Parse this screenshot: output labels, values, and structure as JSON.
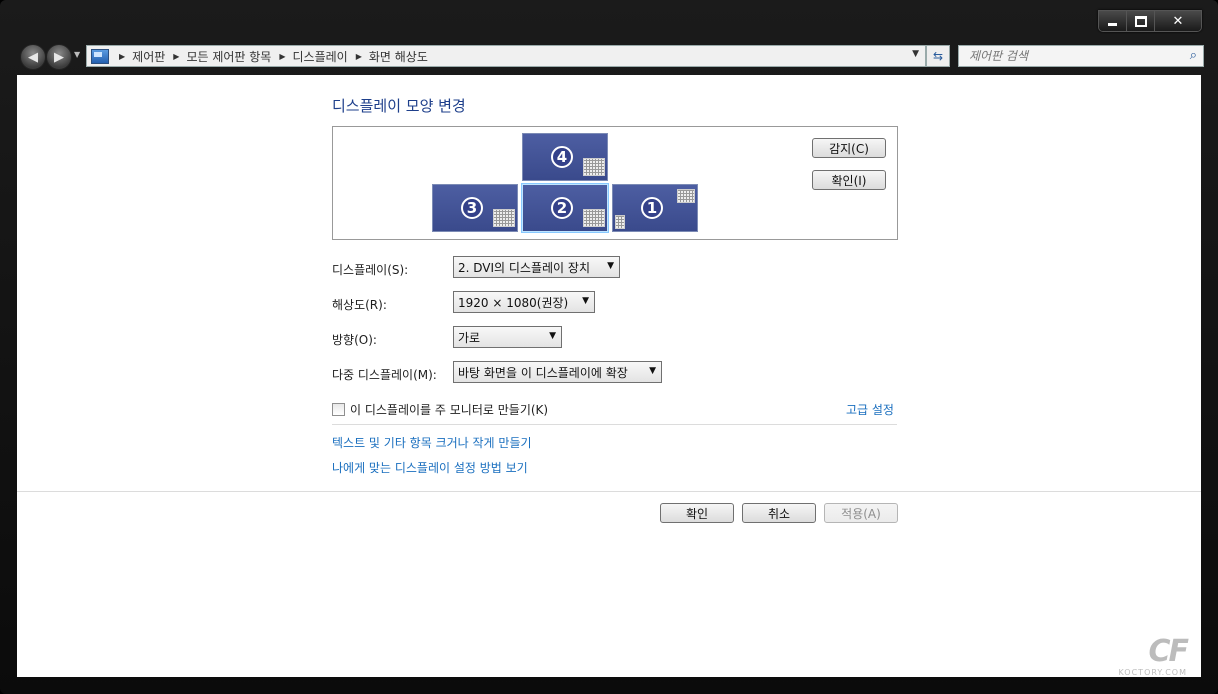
{
  "window": {
    "minimize": "",
    "maximize": "",
    "close": "✕"
  },
  "nav": {
    "breadcrumbs": [
      "제어판",
      "모든 제어판 항목",
      "디스플레이",
      "화면 해상도"
    ],
    "search_placeholder": "제어판 검색"
  },
  "page": {
    "title": "디스플레이 모양 변경",
    "detect_button": "감지(C)",
    "identify_button": "확인(I)",
    "monitors": [
      {
        "number": "4",
        "selected": false
      },
      {
        "number": "3",
        "selected": false
      },
      {
        "number": "2",
        "selected": true
      },
      {
        "number": "1",
        "selected": false
      }
    ],
    "fields": {
      "display": {
        "label": "디스플레이(S):",
        "value": "2. DVI의 디스플레이 장치"
      },
      "resolution": {
        "label": "해상도(R):",
        "value": "1920 × 1080(권장)"
      },
      "orientation": {
        "label": "방향(O):",
        "value": "가로"
      },
      "multiple": {
        "label": "다중 디스플레이(M):",
        "value": "바탕 화면을 이 디스플레이에 확장"
      }
    },
    "make_main_checkbox": "이 디스플레이를 주 모니터로 만들기(K)",
    "make_main_checked": false,
    "advanced_link": "고급 설정",
    "links": [
      "텍스트 및 기타 항목 크거나 작게 만들기",
      "나에게 맞는 디스플레이 설정 방법 보기"
    ],
    "ok_button": "확인",
    "cancel_button": "취소",
    "apply_button": "적용(A)"
  },
  "watermark": {
    "logo": "CF",
    "text": "KOCTORY.COM"
  }
}
